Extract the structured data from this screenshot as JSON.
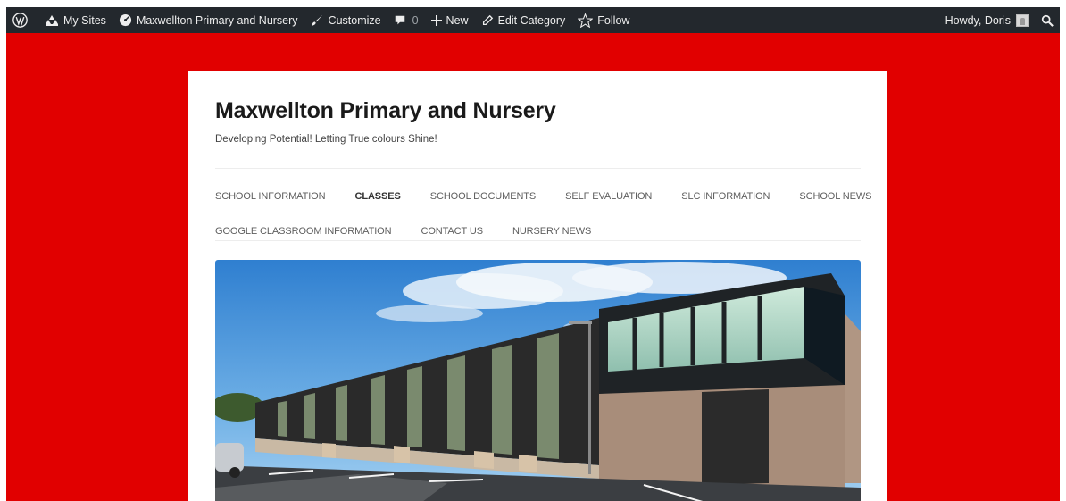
{
  "admin_bar": {
    "wp_logo_icon": "wordpress-logo-icon",
    "my_sites_label": "My Sites",
    "site_name_label": "Maxwellton Primary and Nursery",
    "customize_label": "Customize",
    "comments_count": "0",
    "new_label": "New",
    "edit_category_label": "Edit Category",
    "follow_label": "Follow",
    "howdy_label": "Howdy, Doris",
    "search_icon": "search-icon"
  },
  "site": {
    "title": "Maxwellton Primary and Nursery",
    "description": "Developing Potential! Letting True colours Shine!",
    "nav": [
      {
        "label": "SCHOOL INFORMATION",
        "current": false
      },
      {
        "label": "CLASSES",
        "current": true
      },
      {
        "label": "SCHOOL DOCUMENTS",
        "current": false
      },
      {
        "label": "SELF EVALUATION",
        "current": false
      },
      {
        "label": "SLC INFORMATION",
        "current": false
      },
      {
        "label": "SCHOOL NEWS",
        "current": false
      },
      {
        "label": "GOOGLE CLASSROOM INFORMATION",
        "current": false
      },
      {
        "label": "CONTACT US",
        "current": false
      },
      {
        "label": "NURSERY NEWS",
        "current": false
      }
    ],
    "hero_image": "school-building-photo"
  },
  "colors": {
    "background": "#e10000",
    "admin_bar": "#23282d",
    "card": "#ffffff"
  }
}
